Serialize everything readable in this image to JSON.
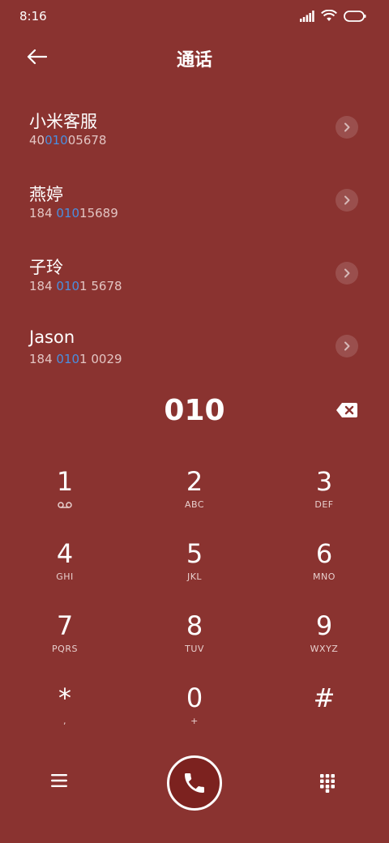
{
  "status_bar": {
    "time": "8:16",
    "icons": [
      "signal-icon",
      "wifi-icon",
      "battery-icon"
    ]
  },
  "header": {
    "title": "通话",
    "back_icon": "back-arrow-icon"
  },
  "contacts": [
    {
      "name": "小米客服",
      "number_pre": "40",
      "number_match": "010",
      "number_post": "05678"
    },
    {
      "name": "燕婷",
      "number_pre": "184 ",
      "number_match": "010",
      "number_post": "15689"
    },
    {
      "name": "子玲",
      "number_pre": "184 ",
      "number_match": "010",
      "number_post": "1 5678"
    },
    {
      "name": "Jason",
      "number_pre": "184 ",
      "number_match": "010",
      "number_post": "1 0029"
    }
  ],
  "dialer": {
    "entered_number": "010"
  },
  "keypad": [
    {
      "digit": "1",
      "letters": ""
    },
    {
      "digit": "2",
      "letters": "ABC"
    },
    {
      "digit": "3",
      "letters": "DEF"
    },
    {
      "digit": "4",
      "letters": "GHI"
    },
    {
      "digit": "5",
      "letters": "JKL"
    },
    {
      "digit": "6",
      "letters": "MNO"
    },
    {
      "digit": "7",
      "letters": "PQRS"
    },
    {
      "digit": "8",
      "letters": "TUV"
    },
    {
      "digit": "9",
      "letters": "WXYZ"
    },
    {
      "digit": "*",
      "letters": ","
    },
    {
      "digit": "0",
      "letters": "+"
    },
    {
      "digit": "#",
      "letters": ""
    }
  ],
  "colors": {
    "background": "#8a3330",
    "match_highlight": "#4a8fe0",
    "call_button": "#7c221f"
  }
}
